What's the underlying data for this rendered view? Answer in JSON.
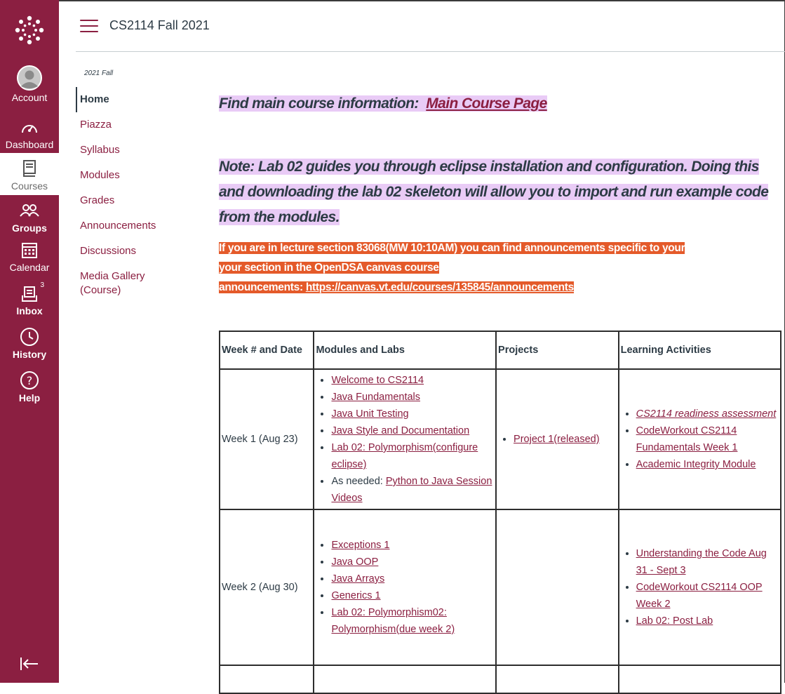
{
  "global_nav": {
    "items": [
      {
        "label": "Account"
      },
      {
        "label": "Dashboard"
      },
      {
        "label": "Courses"
      },
      {
        "label": "Groups"
      },
      {
        "label": "Calendar"
      },
      {
        "label": "Inbox",
        "badge": "3"
      },
      {
        "label": "History"
      },
      {
        "label": "Help"
      }
    ]
  },
  "header": {
    "course_title": "CS2114 Fall 2021"
  },
  "course_nav": {
    "term": "2021 Fall",
    "items": [
      {
        "label": "Home"
      },
      {
        "label": "Piazza"
      },
      {
        "label": "Syllabus"
      },
      {
        "label": "Modules"
      },
      {
        "label": "Grades"
      },
      {
        "label": "Announcements"
      },
      {
        "label": "Discussions"
      },
      {
        "label": "Media Gallery\n(Course)"
      }
    ]
  },
  "content": {
    "find_info": "Find main course information: ",
    "main_link": "Main Course Page",
    "note": "Note: Lab 02 guides you through eclipse installation and configuration.  Doing this and downloading the lab 02 skeleton will allow you to import and run example code from  the modules.",
    "warn_line1": "If you are in lecture section 83068(MW 10:10AM)  you can find announcements specific to your",
    "warn_line2": "your section in the OpenDSA canvas course",
    "warn_line3": "announcements: ",
    "warn_link": "https://canvas.vt.edu/courses/135845/announcements"
  },
  "table": {
    "headers": [
      "Week # and Date",
      "Modules and Labs",
      "Projects",
      "Learning Activities"
    ],
    "rows": [
      {
        "week": "Week 1 (Aug 23)",
        "modules": [
          "Welcome to CS2114",
          "Java Fundamentals",
          "Java Unit Testing",
          "Java Style and Documentation",
          "Lab 02: Polymorphism(configure eclipse)"
        ],
        "as_needed_prefix": "As needed: ",
        "as_needed_link": "Python to Java Session Videos",
        "projects": [
          "Project 1(released)"
        ],
        "activities": [
          "CS2114 readiness assessment",
          "CodeWorkout CS2114 Fundamentals Week 1",
          "Academic Integrity Module"
        ]
      },
      {
        "week": "Week 2 (Aug 30)",
        "modules": [
          "Exceptions 1",
          "Java OOP",
          "Java Arrays",
          "Generics 1",
          "Lab 02: Polymorphism02: Polymorphism(due week 2)"
        ],
        "projects": [],
        "activities": [
          "Understanding the Code Aug 31 - Sept 3",
          "CodeWorkout CS2114 OOP Week 2",
          " Lab 02: Post Lab"
        ]
      }
    ]
  },
  "colors": {
    "brand": "#8b1f41",
    "highlight_purple": "#e9cbf6",
    "warning": "#e45a2a"
  }
}
